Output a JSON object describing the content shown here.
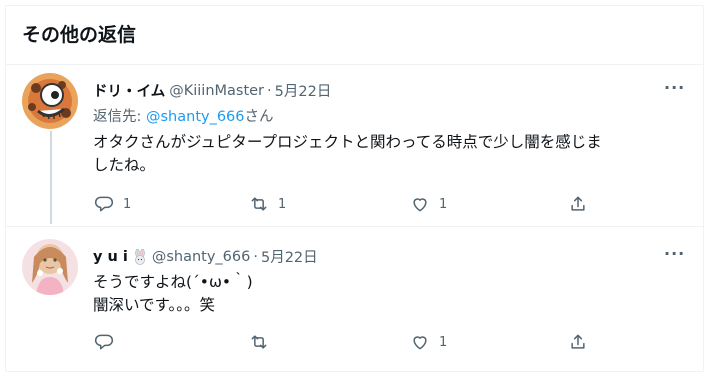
{
  "section": {
    "title": "その他の返信"
  },
  "tweets": [
    {
      "display_name": "ドリ・イム",
      "handle": "@KiiinMaster",
      "separator": "·",
      "date": "5月22日",
      "more": "···",
      "reply_to": {
        "prefix": "返信先: ",
        "mention": "@shanty_666",
        "suffix": "さん"
      },
      "body_lines": [
        "オタクさんがジュピタープロジェクトと関わってる時点で少し闇を感じま",
        "したね。"
      ],
      "actions": {
        "replies": "1",
        "retweets": "1",
        "likes": "1"
      }
    },
    {
      "display_name": "y u i",
      "handle": "@shanty_666",
      "separator": "·",
      "date": "5月22日",
      "more": "···",
      "body_lines": [
        "そうですよね(´•ω•｀)",
        "闇深いです。。。笑"
      ],
      "actions": {
        "replies": "",
        "retweets": "",
        "likes": "1"
      }
    }
  ],
  "icons": {
    "reply": "reply-icon",
    "retweet": "retweet-icon",
    "like": "heart-icon",
    "share": "share-icon",
    "more": "more-icon",
    "emoji": "rabbit-emoji-icon"
  },
  "colors": {
    "link": "#1d9bf0",
    "muted": "#536471",
    "text": "#0f1419",
    "thread_line": "#cfd9de"
  }
}
